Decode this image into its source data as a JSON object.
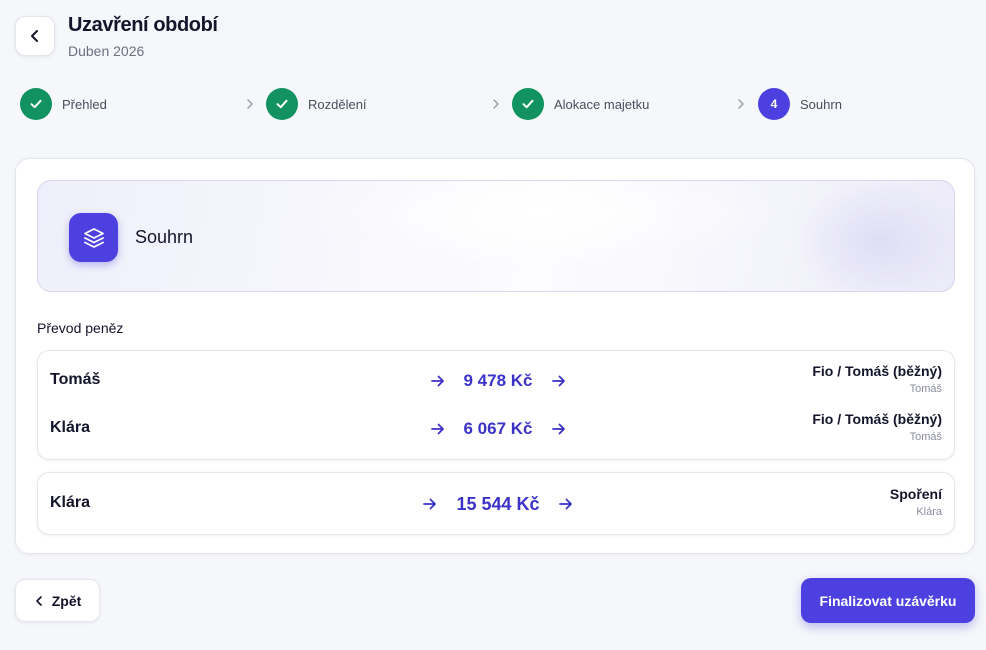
{
  "header": {
    "title": "Uzavření období",
    "subtitle": "Duben 2026"
  },
  "steps": [
    {
      "label": "Přehled",
      "status": "done"
    },
    {
      "label": "Rozdělení",
      "status": "done"
    },
    {
      "label": "Alokace majetku",
      "status": "done"
    },
    {
      "label": "Souhrn",
      "status": "active",
      "number": "4"
    }
  ],
  "summary": {
    "title": "Souhrn",
    "icon": "layers-icon"
  },
  "transfers": {
    "section_title": "Převod peněz",
    "groups": [
      {
        "rows": [
          {
            "from": "Tomáš",
            "amount": "9 478 Kč",
            "to_account": "Fio / Tomáš (běžný)",
            "to_owner": "Tomáš"
          },
          {
            "from": "Klára",
            "amount": "6 067 Kč",
            "to_account": "Fio / Tomáš (běžný)",
            "to_owner": "Tomáš"
          }
        ]
      },
      {
        "rows": [
          {
            "from": "Klára",
            "amount": "15 544 Kč",
            "to_account": "Spoření",
            "to_owner": "Klára"
          }
        ]
      }
    ]
  },
  "footer": {
    "back_label": "Zpět",
    "finalize_label": "Finalizovat uzávěrku"
  },
  "colors": {
    "accent": "#4c41e0",
    "success": "#119260",
    "amount": "#3b32c8"
  }
}
